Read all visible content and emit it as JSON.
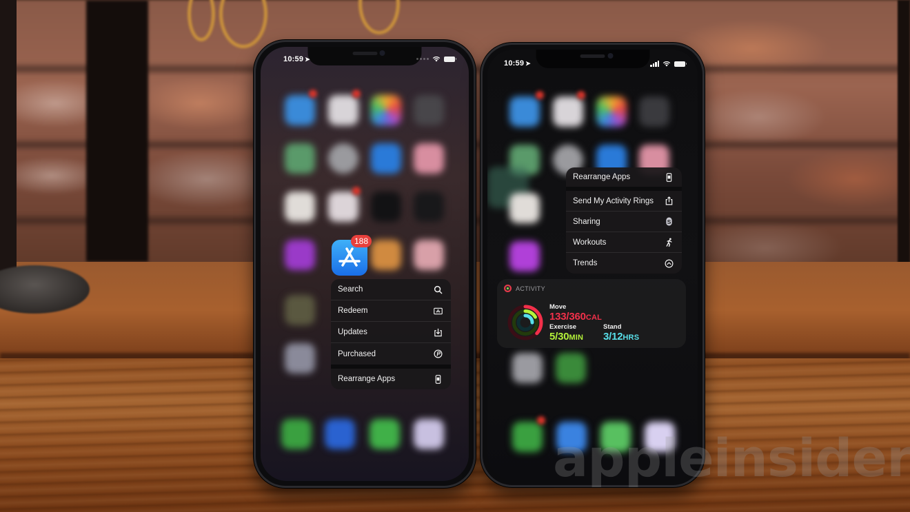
{
  "scene": {
    "description": "Two iPhones side by side on a wooden table in front of a brick wall, showing iOS Haptic Touch quick action menus"
  },
  "left_phone": {
    "status": {
      "time": "10:59",
      "location_icon": "location-arrow-icon",
      "wifi_icon": "wifi-icon",
      "battery_icon": "battery-icon"
    },
    "app": {
      "name": "App Store",
      "badge": "188",
      "color": "#1a6ee8"
    },
    "menu": {
      "items": [
        {
          "label": "Search",
          "icon": "search-icon"
        },
        {
          "label": "Redeem",
          "icon": "redeem-card-icon"
        },
        {
          "label": "Updates",
          "icon": "download-tray-icon"
        },
        {
          "label": "Purchased",
          "icon": "purchased-p-circle-icon"
        },
        {
          "label": "Rearrange Apps",
          "icon": "phone-rearrange-icon"
        }
      ]
    }
  },
  "right_phone": {
    "status": {
      "time": "10:59",
      "location_icon": "location-arrow-icon",
      "signal_icon": "cellular-signal-icon",
      "wifi_icon": "wifi-icon",
      "battery_icon": "battery-icon"
    },
    "menu": {
      "items": [
        {
          "label": "Rearrange Apps",
          "icon": "phone-rearrange-icon"
        },
        {
          "label": "Send My Activity Rings",
          "icon": "share-icon"
        },
        {
          "label": "Sharing",
          "icon": "sharing-s-icon"
        },
        {
          "label": "Workouts",
          "icon": "running-figure-icon"
        },
        {
          "label": "Trends",
          "icon": "trends-chevron-up-circle-icon"
        }
      ]
    },
    "widget": {
      "title": "ACTIVITY",
      "move": {
        "label": "Move",
        "value": "133/360",
        "unit": "CAL",
        "color": "#f2304a",
        "progress": 0.37
      },
      "exercise": {
        "label": "Exercise",
        "value": "5/30",
        "unit": "MIN",
        "color": "#b4f23a",
        "progress": 0.17
      },
      "stand": {
        "label": "Stand",
        "value": "3/12",
        "unit": "HRS",
        "color": "#58e0ea",
        "progress": 0.25
      }
    }
  },
  "watermark": {
    "text": "appleinsider"
  }
}
